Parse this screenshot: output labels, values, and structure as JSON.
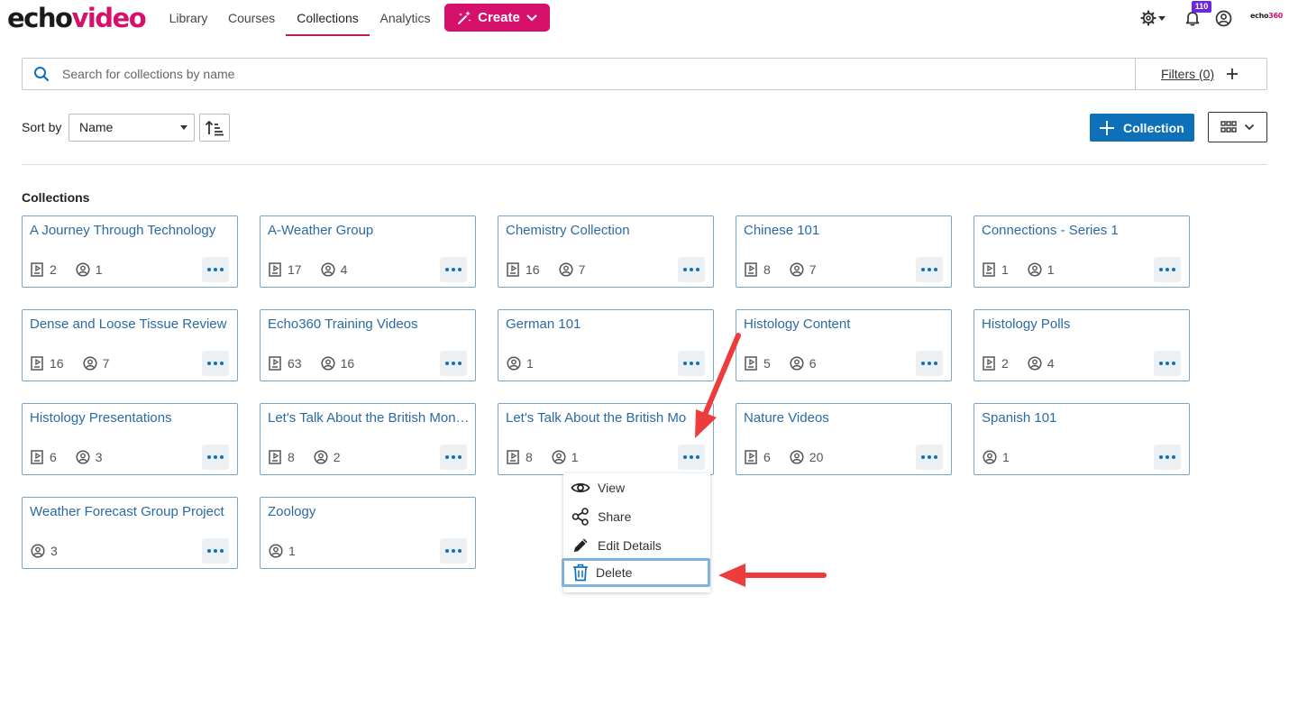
{
  "app": {
    "logo_part1": "echo",
    "logo_part2": "video",
    "brand_small_part1": "echo",
    "brand_small_part2": "360"
  },
  "nav": {
    "items": [
      {
        "label": "Library"
      },
      {
        "label": "Courses"
      },
      {
        "label": "Collections"
      },
      {
        "label": "Analytics"
      }
    ],
    "active": "Collections",
    "create_label": "Create",
    "notification_count": "110"
  },
  "search": {
    "placeholder": "Search for collections by name",
    "value": "",
    "filters_label": "Filters (0)"
  },
  "sort": {
    "label": "Sort by",
    "selected": "Name"
  },
  "toolbar": {
    "add_collection_label": "Collection"
  },
  "section": {
    "title": "Collections"
  },
  "collections": [
    {
      "title": "A Journey Through Technology",
      "media": "2",
      "users": "1"
    },
    {
      "title": "A-Weather Group",
      "media": "17",
      "users": "4"
    },
    {
      "title": "Chemistry Collection",
      "media": "16",
      "users": "7"
    },
    {
      "title": "Chinese 101",
      "media": "8",
      "users": "7"
    },
    {
      "title": "Connections - Series 1",
      "media": "1",
      "users": "1"
    },
    {
      "title": "Dense and Loose Tissue Review",
      "media": "16",
      "users": "7"
    },
    {
      "title": "Echo360 Training Videos",
      "media": "63",
      "users": "16"
    },
    {
      "title": "German 101",
      "media": null,
      "users": "1"
    },
    {
      "title": "Histology Content",
      "media": "5",
      "users": "6"
    },
    {
      "title": "Histology Polls",
      "media": "2",
      "users": "4"
    },
    {
      "title": "Histology Presentations",
      "media": "6",
      "users": "3"
    },
    {
      "title": "Let's Talk About the British Monarchy",
      "media": "8",
      "users": "2"
    },
    {
      "title": "Let's Talk About the British Mo",
      "media": "8",
      "users": "1"
    },
    {
      "title": "Nature Videos",
      "media": "6",
      "users": "20"
    },
    {
      "title": "Spanish 101",
      "media": null,
      "users": "1"
    },
    {
      "title": "Weather Forecast Group Project",
      "media": null,
      "users": "3"
    },
    {
      "title": "Zoology",
      "media": null,
      "users": "1"
    }
  ],
  "context_menu": {
    "items": [
      {
        "label": "View",
        "icon": "eye-icon"
      },
      {
        "label": "Share",
        "icon": "share-icon"
      },
      {
        "label": "Edit Details",
        "icon": "pencil-icon"
      },
      {
        "label": "Delete",
        "icon": "trash-icon"
      }
    ],
    "focused": "Delete"
  },
  "colors": {
    "brand_pink": "#d6116c",
    "primary_blue": "#0e70b8",
    "card_border": "#73a7cf",
    "card_title": "#2b6aa5",
    "annotation_red": "#ee3b3b",
    "badge_purple": "#6d28d9"
  }
}
